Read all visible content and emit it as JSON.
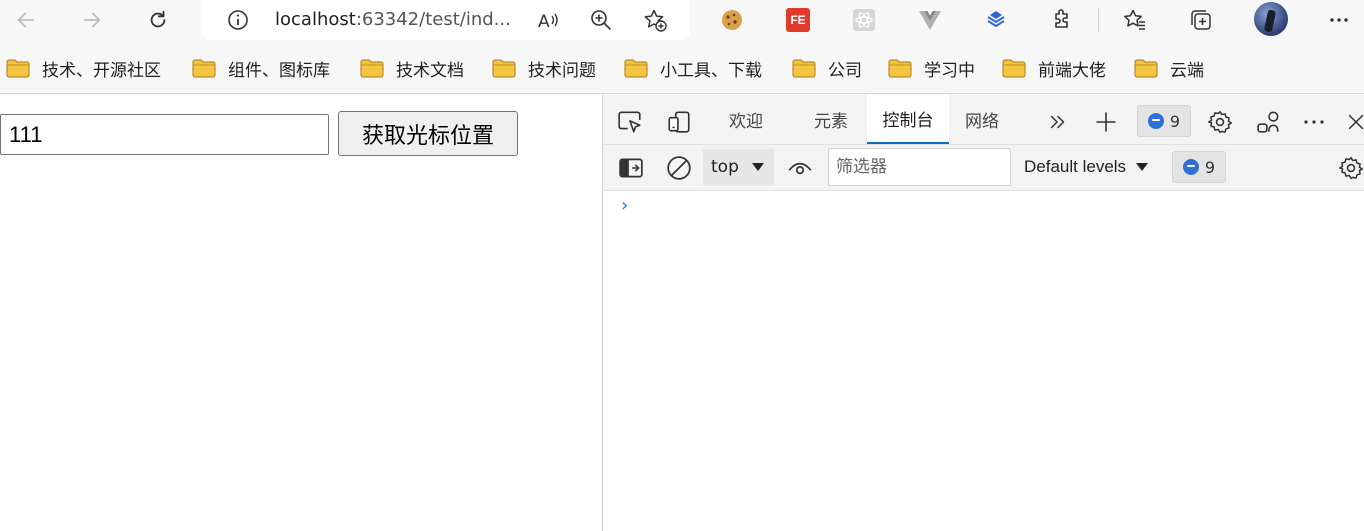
{
  "browser": {
    "address": {
      "host": "localhost",
      "rest": ":63342/test/ind..."
    },
    "icons": [
      "back-arrow-icon",
      "forward-arrow-icon",
      "refresh-icon",
      "info-icon",
      "read-aloud-icon",
      "zoom-icon",
      "favorite-add-icon",
      "cookie-extension-icon",
      "fe-extension-icon",
      "react-extension-icon",
      "vue-extension-icon",
      "stack-extension-icon",
      "puzzle-extensions-icon",
      "favorites-icon",
      "collections-icon",
      "profile-avatar",
      "more-icon"
    ],
    "fe_label": "FE"
  },
  "bookmarks": [
    {
      "label": "技术、开源社区"
    },
    {
      "label": "组件、图标库"
    },
    {
      "label": "技术文档"
    },
    {
      "label": "技术问题"
    },
    {
      "label": "小工具、下载"
    },
    {
      "label": "公司"
    },
    {
      "label": "学习中"
    },
    {
      "label": "前端大佬"
    },
    {
      "label": "云端"
    }
  ],
  "page": {
    "input_value": "111",
    "button_label": "获取光标位置"
  },
  "devtools": {
    "tabs": [
      {
        "label": "欢迎"
      },
      {
        "label": "元素"
      },
      {
        "label": "控制台"
      },
      {
        "label": "网络"
      }
    ],
    "issues_count": "9",
    "context": "top",
    "filter_placeholder": "筛选器",
    "levels": "Default levels",
    "prompt": "›"
  },
  "colors": {
    "accent": "#0f6cbd",
    "bubble": "#2f6fd6",
    "folder": "#f5c542"
  }
}
